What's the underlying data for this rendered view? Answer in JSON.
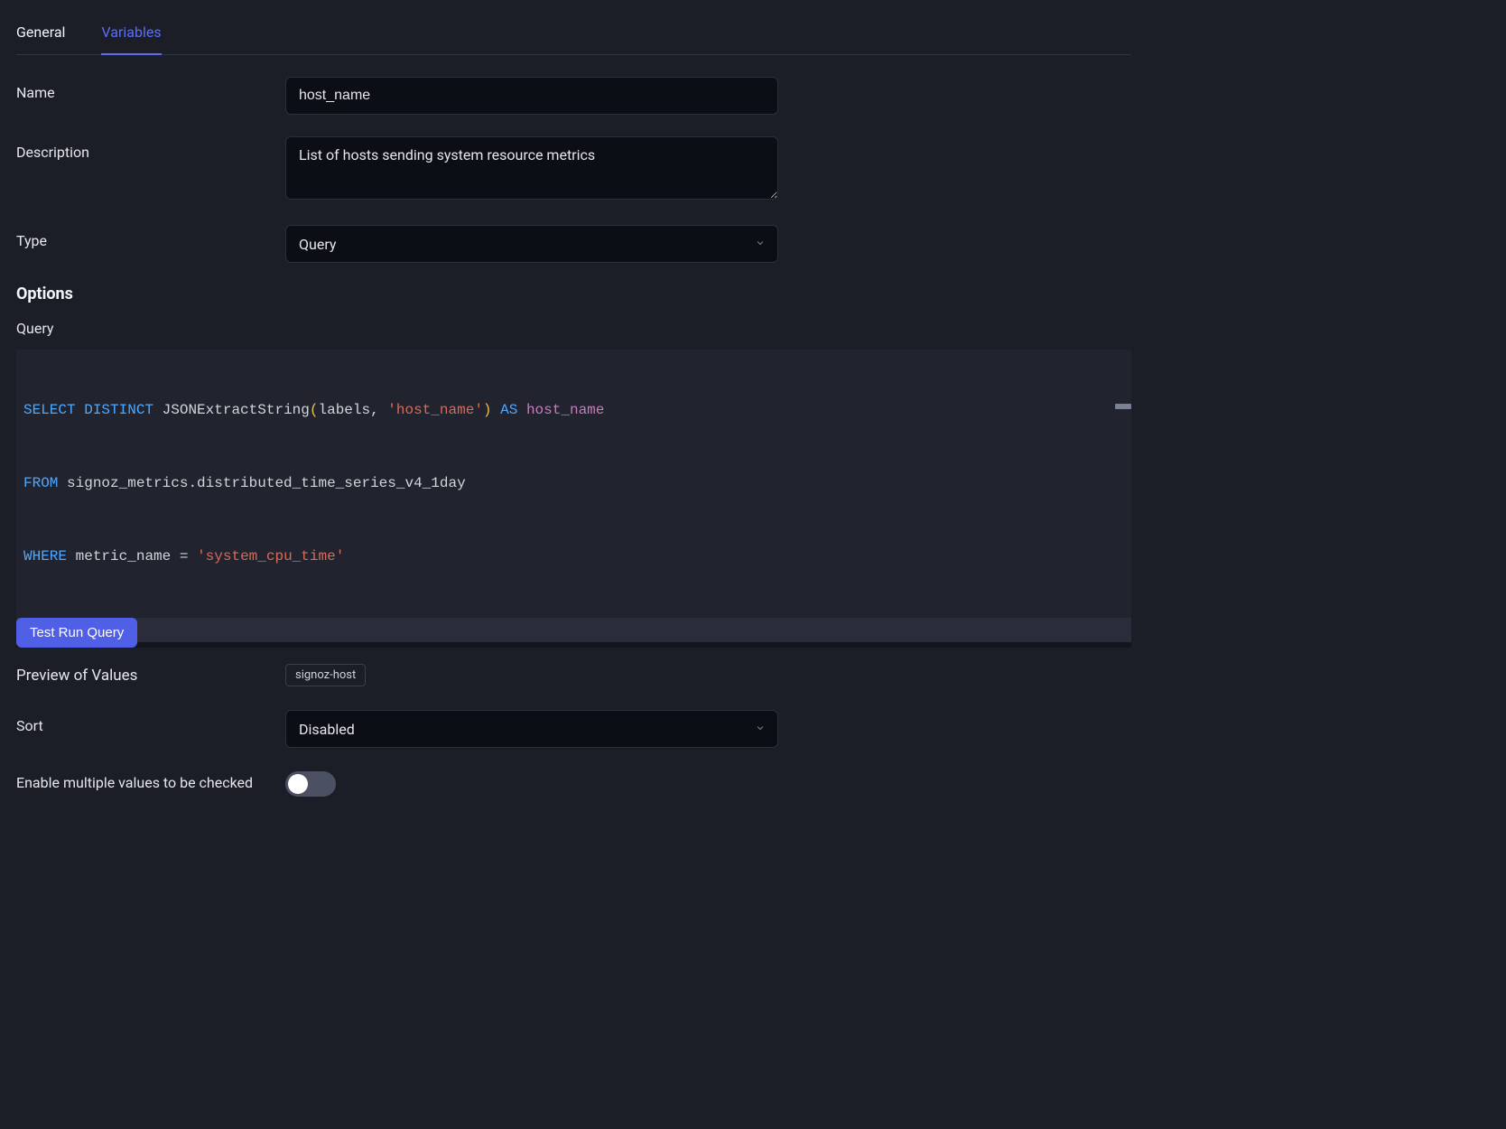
{
  "tabs": {
    "general": "General",
    "variables": "Variables",
    "active": "variables"
  },
  "fields": {
    "name": {
      "label": "Name",
      "value": "host_name"
    },
    "description": {
      "label": "Description",
      "value": "List of hosts sending system resource metrics"
    },
    "type": {
      "label": "Type",
      "value": "Query"
    }
  },
  "options": {
    "heading": "Options",
    "queryLabel": "Query",
    "query": {
      "raw": "SELECT DISTINCT JSONExtractString(labels, 'host_name') AS host_name\nFROM signoz_metrics.distributed_time_series_v4_1day\nWHERE metric_name = 'system_cpu_time'",
      "tokens": {
        "l1_select": "SELECT",
        "l1_distinct": "DISTINCT",
        "l1_func": "JSONExtractString",
        "l1_arg1": "labels",
        "l1_arg2": "'host_name'",
        "l1_as": "AS",
        "l1_alias": "host_name",
        "l2_from": "FROM",
        "l2_table": "signoz_metrics.distributed_time_series_v4_1day",
        "l3_where": "WHERE",
        "l3_col": "metric_name",
        "l3_val": "'system_cpu_time'"
      }
    },
    "testButton": "Test Run Query"
  },
  "preview": {
    "label": "Preview of Values",
    "values": [
      "signoz-host"
    ]
  },
  "sort": {
    "label": "Sort",
    "value": "Disabled"
  },
  "multi": {
    "label": "Enable multiple values to be checked",
    "value": false
  }
}
